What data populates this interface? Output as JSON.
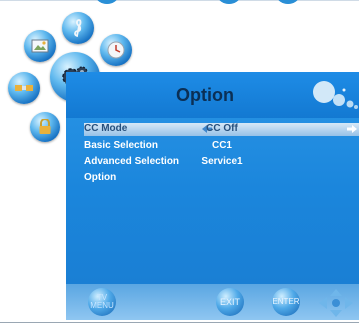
{
  "menu": {
    "title": "Option",
    "rows": [
      {
        "label": "CC Mode",
        "value": "CC Off",
        "selected": true
      },
      {
        "label": "Basic Selection",
        "value": "CC1"
      },
      {
        "label": "Advanced Selection",
        "value": "Service1"
      },
      {
        "label": "Option",
        "value": ""
      }
    ]
  },
  "footer": {
    "menu_label_top": "TV",
    "menu_label_bottom": "MENU",
    "exit_label": "EXIT",
    "enter_label": "ENTER"
  },
  "side_icons": [
    "picture-icon",
    "music-icon",
    "clock-icon",
    "satellite-icon",
    "settings-gear-icon",
    "lock-icon"
  ],
  "colors": {
    "panel_blue": "#1b86dc",
    "title_text": "#0b2f55",
    "selected_row": "#b4d4f0"
  }
}
